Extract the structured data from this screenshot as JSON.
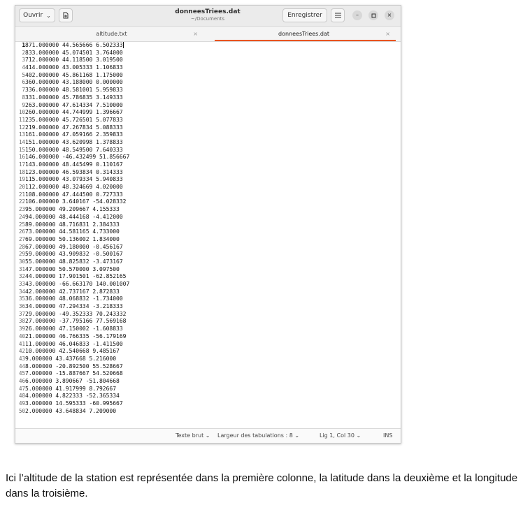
{
  "header": {
    "open_label": "Ouvrir",
    "title": "donneesTriees.dat",
    "path": "~/Documents",
    "save_label": "Enregistrer"
  },
  "tabs": [
    {
      "label": "altitude.txt",
      "active": false
    },
    {
      "label": "donneesTriees.dat",
      "active": true
    }
  ],
  "lines": [
    "871.000000 44.565666 6.502333",
    "833.000000 45.074501 3.764000",
    "712.000000 44.118500 3.019500",
    "414.000000 43.005333 1.106833",
    "402.000000 45.861168 1.175000",
    "360.000000 43.188000 0.000000",
    "336.000000 48.581001 5.959833",
    "331.000000 45.786835 3.149333",
    "263.000000 47.614334 7.510000",
    "260.000000 44.744999 1.396667",
    "235.000000 45.726501 5.077833",
    "219.000000 47.267834 5.088333",
    "161.000000 47.059166 2.359833",
    "151.000000 43.620998 1.378833",
    "150.000000 48.549500 7.640333",
    "146.000000 -46.432499 51.856667",
    "143.000000 48.445499 0.110167",
    "123.000000 46.593834 0.314333",
    "115.000000 43.079334 5.940833",
    "112.000000 48.324669 4.020000",
    "108.000000 47.444500 0.727333",
    "106.000000 3.640167 -54.028332",
    "95.000000 49.209667 4.155333",
    "94.000000 48.444168 -4.412000",
    "89.000000 48.716831 2.384333",
    "73.000000 44.581165 4.733000",
    "69.000000 50.136002 1.834000",
    "67.000000 49.180000 -0.456167",
    "59.000000 43.909832 -0.500167",
    "55.000000 48.825832 -3.473167",
    "47.000000 50.570000 3.097500",
    "44.000000 17.901501 -62.852165",
    "43.000000 -66.663170 140.001007",
    "42.000000 42.737167 2.872833",
    "36.000000 48.068832 -1.734000",
    "34.000000 47.294334 -3.218333",
    "29.000000 -49.352333 70.243332",
    "27.000000 -37.795166 77.569168",
    "26.000000 47.150002 -1.608833",
    "21.000000 46.766335 -56.179169",
    "11.000000 46.046833 -1.411500",
    "10.000000 42.540668 9.485167",
    "9.000000 43.437668 5.216000",
    "8.000000 -20.892500 55.528667",
    "7.000000 -15.887667 54.520668",
    "6.000000 3.890667 -51.804668",
    "5.000000 41.917999 8.792667",
    "4.000000 4.822333 -52.365334",
    "3.000000 14.595333 -60.995667",
    "2.000000 43.648834 7.209000"
  ],
  "status": {
    "syntax": "Texte brut",
    "tab_width": "Largeur des tabulations : 8",
    "position": "Lig 1, Col 30",
    "mode": "INS"
  },
  "caption": "Ici l’altitude de la station est représentée dans la première colonne, la latitude dans la deuxième et la longitude dans la troisième."
}
